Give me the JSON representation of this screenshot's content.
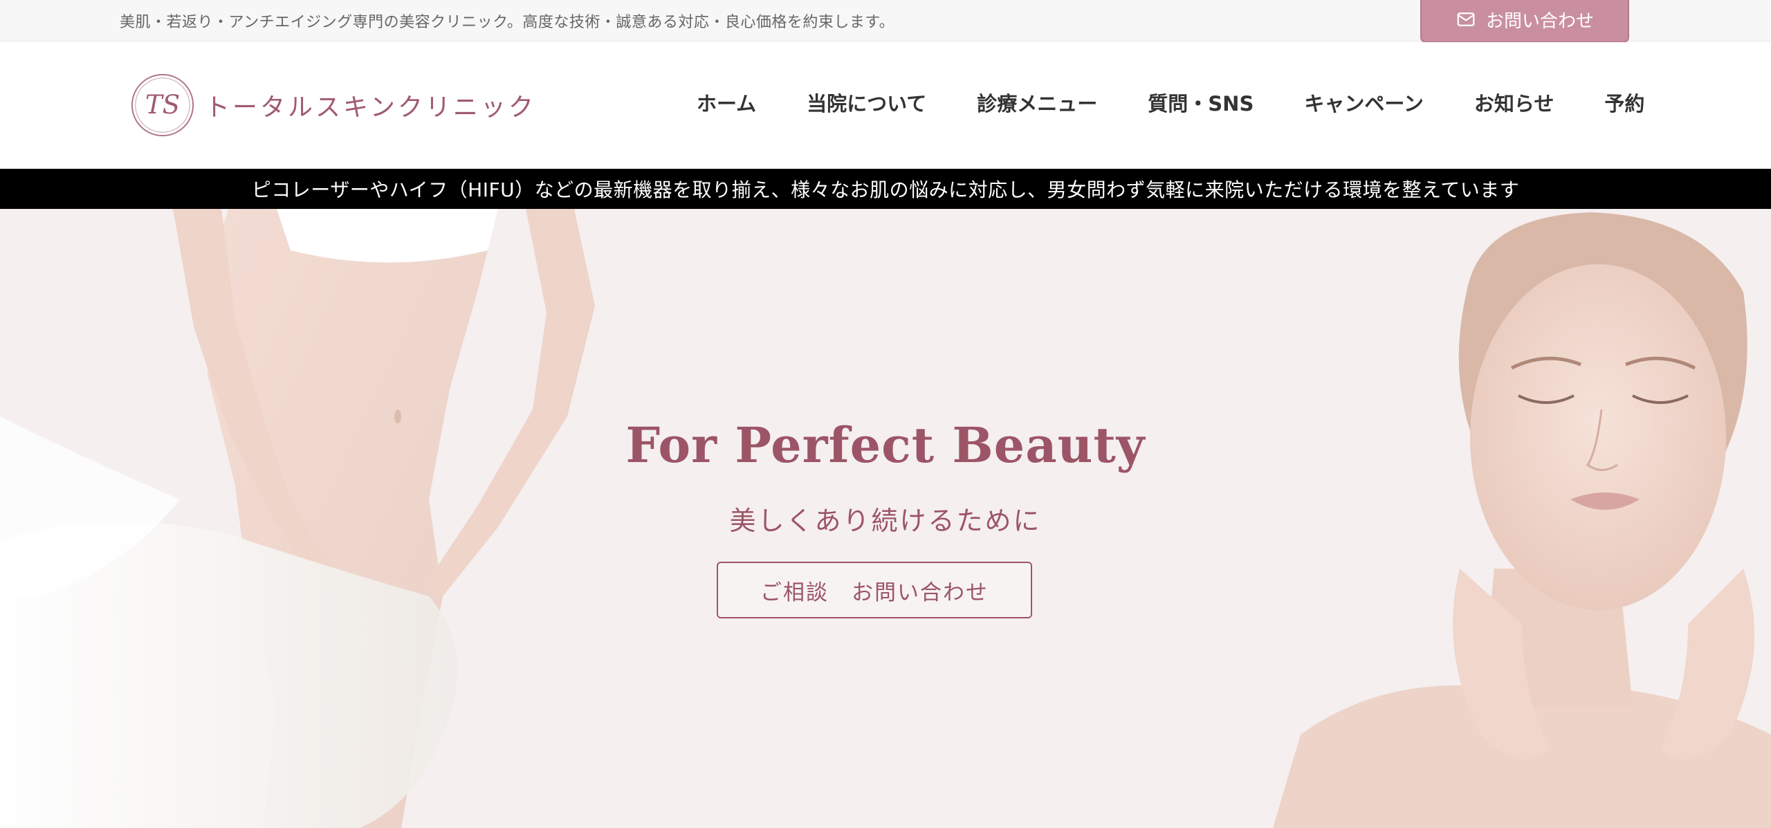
{
  "topbar": {
    "text": "美肌・若返り・アンチエイジング専門の美容クリニック。高度な技術・誠意ある対応・良心価格を約束します。",
    "contact_button": "お問い合わせ",
    "contact_icon": "mail-icon"
  },
  "header": {
    "logo_monogram": "TS",
    "logo_text": "トータルスキンクリニック",
    "nav": [
      {
        "label": "ホーム"
      },
      {
        "label": "当院について"
      },
      {
        "label": "診療メニュー"
      },
      {
        "label": "質問・SNS"
      },
      {
        "label": "キャンペーン"
      },
      {
        "label": "お知らせ"
      },
      {
        "label": "予約"
      }
    ]
  },
  "announcement": {
    "text": "ピコレーザーやハイフ（HIFU）などの最新機器を取り揃え、様々なお肌の悩みに対応し、男女問わず気軽に来院いただける環境を整えています"
  },
  "hero": {
    "title": "For Perfect Beauty",
    "subtitle": "美しくあり続けるために",
    "button": "ご相談　お問い合わせ"
  },
  "colors": {
    "accent": "#9c5566",
    "button_pink": "#c98fa0",
    "hero_bg": "#f5efef",
    "announce_bg": "#000000"
  }
}
